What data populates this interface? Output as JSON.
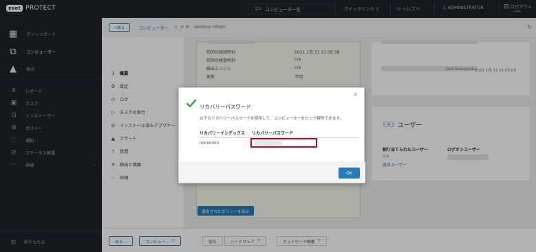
{
  "app": {
    "badge": "eset",
    "name": "PROTECT"
  },
  "topbar": {
    "search": "コンピューター名",
    "quick_links": "クイックリンク ▽",
    "help": "ヘルプ ▽",
    "user": "ADMINISTRATOR",
    "logout": "ログアウト",
    "logout_sub": ">9m"
  },
  "sidebar": {
    "items": [
      {
        "label": "ダッシュボード"
      },
      {
        "label": "コンピューター"
      },
      {
        "label": "検出"
      },
      {
        "label": "レポート"
      },
      {
        "label": "タスク"
      },
      {
        "label": "インストーラー"
      },
      {
        "label": "ポリシー"
      },
      {
        "label": "通知"
      },
      {
        "label": "ステータス概要"
      },
      {
        "label": "詳細"
      }
    ],
    "collapse": "折りたたみ"
  },
  "breadcrumb": {
    "back": "＜戻る",
    "computers": "コンピューター",
    "separator": ">",
    "device": "desktop-r6bph"
  },
  "detail_nav": [
    {
      "label": "概要"
    },
    {
      "label": "設定"
    },
    {
      "label": "ログ"
    },
    {
      "label": "タスクの実行"
    },
    {
      "label": "インストール済みアプリケー"
    },
    {
      "label": "アラート"
    },
    {
      "label": "質問"
    },
    {
      "label": "検出と隔離"
    },
    {
      "label": "詳細"
    }
  ],
  "content": {
    "rows": [
      {
        "label": "前回の接続時刻",
        "value": "2021 1月 31 21:06:38"
      },
      {
        "label": "前回の検査時刻",
        "value": "n/a"
      },
      {
        "label": "検出エンジン",
        "value": "n/a"
      },
      {
        "label": "更新",
        "value": "不明"
      }
    ],
    "policy_button": "適用されたポリシーを表示",
    "encryption_text": "Disk Encryption",
    "encryption_date": "2021 1月 31 21:03:00",
    "users_title": "ユーザー",
    "assigned_users": "割り当てられたユーザー",
    "login_users": "ログオンユーザー",
    "assigned_value": "n/a",
    "add_user": "追加ユーザー"
  },
  "bottombar": {
    "back": "戻る...",
    "computer": "コンピュー...",
    "save": "保存",
    "hardware": "ハードウェア",
    "network": "ネットワーク概要"
  },
  "modal": {
    "title": "リカバリーパスワード",
    "description": "以下のリカバリーパスワードを使用して、コンピューターをロック解除できます。",
    "col_index": "リカバリーインデックス",
    "col_password": "リカバリーパスワード",
    "index_value": "00000000",
    "ok": "OK",
    "close": "×"
  },
  "colors": {
    "accent": "#2a7ab8",
    "topbar": "#1f2329",
    "highlight": "#d0021b",
    "check": "#3fa33b"
  }
}
